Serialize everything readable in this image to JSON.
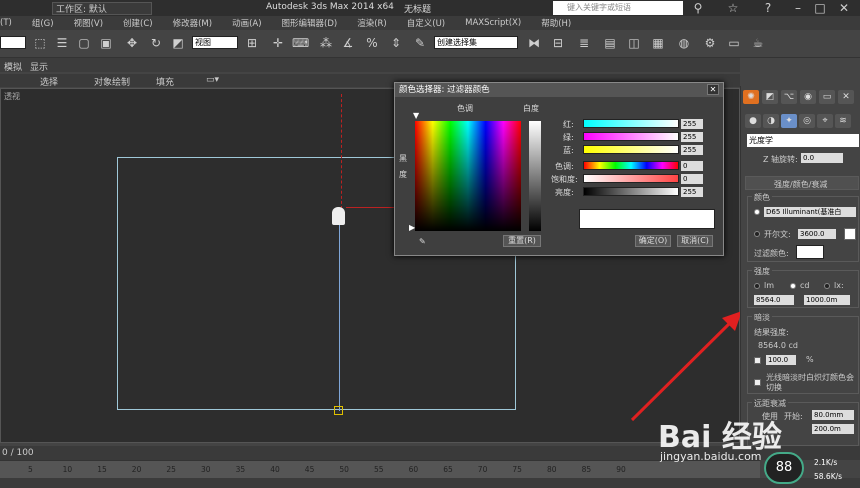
{
  "titlebar": {
    "workspace": "工作区: 默认",
    "app_title": "Autodesk 3ds Max  2014 x64",
    "doc_title": "无标题",
    "search_placeholder": "键入关键字或短语"
  },
  "menu": [
    "(T)",
    "组(G)",
    "视图(V)",
    "创建(C)",
    "修改器(M)",
    "动画(A)",
    "图形编辑器(D)",
    "渲染(R)",
    "自定义(U)",
    "MAXScript(X)",
    "帮助(H)"
  ],
  "toolbar": {
    "view_select": "视图",
    "selection_set": "创建选择集"
  },
  "ribbon": {
    "tab1": "模拟",
    "tab2": "显示",
    "sub1": "选择",
    "sub2": "对象绘制",
    "sub3": "填充"
  },
  "viewport": {
    "label": "透视"
  },
  "dialog": {
    "title": "颜色选择器: 过滤器颜色",
    "hue_label": "色调",
    "white_label": "白度",
    "black_label": "黑",
    "degree_label": "度",
    "red_label": "红:",
    "green_label": "绿:",
    "blue_label": "蓝:",
    "hue2_label": "色调:",
    "sat_label": "饱和度:",
    "val_label": "亮度:",
    "red": "255",
    "green": "255",
    "blue": "255",
    "hue": "0",
    "sat": "0",
    "val": "255",
    "reset": "重置(R)",
    "ok": "确定(O)",
    "cancel": "取消(C)"
  },
  "rightpanel": {
    "category": "光度学",
    "z_rotate_label": "Z 轴旋转:",
    "z_rotate_value": "0.0",
    "rollout_title": "强度/颜色/衰减",
    "color_group": "颜色",
    "illuminant": "D65 Illuminant(基准白",
    "kelvin_label": "开尔文:",
    "kelvin_value": "3600.0",
    "filter_color_label": "过滤颜色:",
    "intensity_group": "强度",
    "unit_lm": "lm",
    "unit_cd": "cd",
    "unit_lx": "lx:",
    "intensity_value": "8564.0",
    "lx_value": "1000.0m",
    "dim_group": "暗淡",
    "result_label": "结果强度:",
    "result_value": "8564.0 cd",
    "percent_value": "100.0",
    "percent_sign": "%",
    "incandescent_label": "光线暗淡时白炽灯颜色会切换",
    "far_atten_label": "远距衰减",
    "use_label": "使用",
    "start_label": "开始:",
    "start_value": "80.0mm",
    "end_value": "200.0m"
  },
  "timeline": {
    "frames": "0 / 100"
  },
  "ruler_ticks": [
    "5",
    "10",
    "15",
    "20",
    "25",
    "30",
    "35",
    "40",
    "45",
    "50",
    "55",
    "60",
    "65",
    "70",
    "75",
    "80",
    "85",
    "90"
  ],
  "perf": {
    "percent": "88",
    "up": "2.1K/s",
    "down": "58.6K/s"
  },
  "watermark": {
    "brand": "Bai 经验",
    "url": "jingyan.baidu.com"
  }
}
